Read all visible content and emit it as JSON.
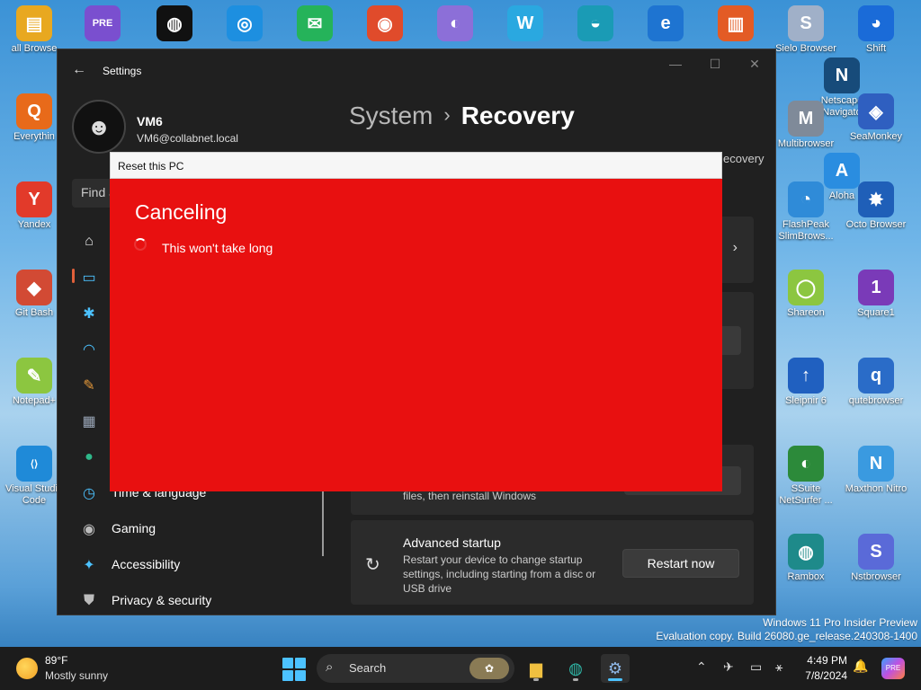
{
  "desktop": {
    "icons": [
      {
        "label": "all Browse",
        "color": "#e8a820",
        "glyph": "▤"
      },
      {
        "label": "",
        "color": "#7a4fcf",
        "glyph": "PRE"
      },
      {
        "label": "",
        "color": "#111111",
        "glyph": "◍"
      },
      {
        "label": "",
        "color": "#1d8fe0",
        "glyph": "◎"
      },
      {
        "label": "",
        "color": "#25b35a",
        "glyph": "✉"
      },
      {
        "label": "",
        "color": "#e04b2b",
        "glyph": "◉"
      },
      {
        "label": "",
        "color": "#8c6fd8",
        "glyph": "◐"
      },
      {
        "label": "",
        "color": "#2aa8e0",
        "glyph": "W"
      },
      {
        "label": "",
        "color": "#1a9bb5",
        "glyph": "◒"
      },
      {
        "label": "",
        "color": "#1e74d1",
        "glyph": "e"
      },
      {
        "label": "",
        "color": "#e35b25",
        "glyph": "▥"
      },
      {
        "label": "Sielo Browser",
        "color": "#a0b0c8",
        "glyph": "S"
      },
      {
        "label": "Shift",
        "color": "#1a6bd8",
        "glyph": "◕"
      },
      {
        "label": "Everythin",
        "color": "#e86a1a",
        "glyph": "Q"
      },
      {
        "label": "Netscape Navigato",
        "color": "#174b7a",
        "glyph": "N"
      },
      {
        "label": "Yandex",
        "color": "#e23a2a",
        "glyph": "Y"
      },
      {
        "label": "Multibrowser",
        "color": "#7f8a99",
        "glyph": "M"
      },
      {
        "label": "SeaMonkey",
        "color": "#2f5fc0",
        "glyph": "◈"
      },
      {
        "label": "Aloha",
        "color": "#2a8de0",
        "glyph": "A"
      },
      {
        "label": "FlashPeak SlimBrows...",
        "color": "#2f8bd8",
        "glyph": "◔"
      },
      {
        "label": "Octo Browser",
        "color": "#1f5fb8",
        "glyph": "✸"
      },
      {
        "label": "Git Bash",
        "color": "#d24a34",
        "glyph": "◆"
      },
      {
        "label": "Shareon",
        "color": "#8cc640",
        "glyph": "◯"
      },
      {
        "label": "Square1",
        "color": "#7a3ab8",
        "glyph": "1"
      },
      {
        "label": "Notepad+",
        "color": "#8cc640",
        "glyph": "✎"
      },
      {
        "label": "Sleipnir 6",
        "color": "#2060c0",
        "glyph": "↑"
      },
      {
        "label": "qutebrowser",
        "color": "#2a6cc8",
        "glyph": "q"
      },
      {
        "label": "Visual Studio Code",
        "color": "#1f8ad8",
        "glyph": "⟨⟩"
      },
      {
        "label": "SSuite NetSurfer ...",
        "color": "#2c8a3a",
        "glyph": "◐"
      },
      {
        "label": "Maxthon Nitro",
        "color": "#3a9ae0",
        "glyph": "N"
      },
      {
        "label": "Rambox",
        "color": "#1e8a8a",
        "glyph": "◍"
      },
      {
        "label": "Nstbrowser",
        "color": "#5a6ad8",
        "glyph": "S"
      }
    ]
  },
  "settings": {
    "title": "Settings",
    "back_icon": "←",
    "minimize_icon": "—",
    "maximize_icon": "☐",
    "close_icon": "✕",
    "user": {
      "name": "VM6",
      "email": "VM6@collabnet.local",
      "avatar_glyph": "☻"
    },
    "search_placeholder": "Find a",
    "nav": [
      {
        "label": "",
        "icon": "⌂",
        "color": "#e8e8e8"
      },
      {
        "label": "",
        "icon": "▭",
        "color": "#4cc2ff"
      },
      {
        "label": "",
        "icon": "✱",
        "color": "#4cc2ff"
      },
      {
        "label": "",
        "icon": "◠",
        "color": "#4cc2ff"
      },
      {
        "label": "",
        "icon": "✎",
        "color": "#e89a3a"
      },
      {
        "label": "",
        "icon": "▦",
        "color": "#9aa6b8"
      },
      {
        "label": "",
        "icon": "●",
        "color": "#2fb88a"
      },
      {
        "label": "Time & language",
        "icon": "◷",
        "color": "#4cc2ff"
      },
      {
        "label": "Gaming",
        "icon": "◉",
        "color": "#bcbcbc"
      },
      {
        "label": "Accessibility",
        "icon": "✦",
        "color": "#4cc2ff"
      },
      {
        "label": "Privacy & security",
        "icon": "⛊",
        "color": "#bcbcbc"
      }
    ],
    "breadcrumb": {
      "parent": "System",
      "separator": "›",
      "current": "Recovery"
    },
    "right_crumb": "ecovery",
    "chevron": "›",
    "reinstall_text": "files, then reinstall Windows",
    "advanced_startup": {
      "title": "Advanced startup",
      "description": "Restart your device to change startup settings, including starting from a disc or USB drive",
      "button": "Restart now",
      "icon": "↻"
    }
  },
  "reset_dialog": {
    "title": "Reset this PC",
    "heading": "Canceling",
    "message": "This won't take long",
    "background": "#e81010"
  },
  "watermark": {
    "line1": "Windows 11 Pro Insider Preview",
    "line2": "Evaluation copy. Build 26080.ge_release.240308-1400"
  },
  "taskbar": {
    "weather": {
      "temp": "89°F",
      "desc": "Mostly sunny"
    },
    "search_label": "Search",
    "search_icon": "⌕",
    "search_badge": "✿",
    "apps": [
      {
        "name": "file-explorer",
        "glyph": "▆",
        "color": "#f0c040"
      },
      {
        "name": "app",
        "glyph": "◍",
        "color": "#2fb8a8"
      },
      {
        "name": "settings",
        "glyph": "⚙",
        "color": "#8fb8e8"
      }
    ],
    "tray_icons": [
      "⌃",
      "✈",
      "▭",
      "⚹"
    ],
    "time": "4:49 PM",
    "date": "7/8/2024",
    "bell_icon": "🔔",
    "copilot_label": "PRE"
  }
}
